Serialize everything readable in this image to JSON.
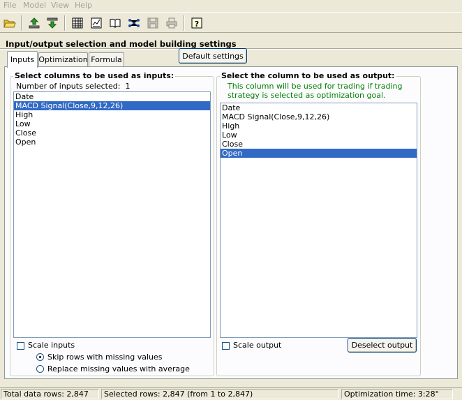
{
  "menu": [
    "File",
    "Model",
    "View",
    "Help"
  ],
  "toolbar": {
    "icons": [
      "open-folder-icon",
      "upload-icon",
      "download-icon",
      "grid-icon",
      "chart-icon",
      "book-icon",
      "network-icon",
      "save-icon",
      "print-icon",
      "help-icon"
    ]
  },
  "section": {
    "title": "Input/output selection and model building settings"
  },
  "tabs": [
    {
      "label": "Inputs",
      "active": true
    },
    {
      "label": "Optimization",
      "active": false
    },
    {
      "label": "Formula",
      "active": false
    }
  ],
  "default_settings_label": "Default settings",
  "inputs": {
    "title": "Select columns to be used as inputs:",
    "count_label": "Number of inputs selected:",
    "count_value": "1",
    "columns": [
      "Date",
      "MACD Signal(Close,9,12,26)",
      "High",
      "Low",
      "Close",
      "Open"
    ],
    "selected_index": 1,
    "scale_label": "Scale inputs",
    "skip_label": "Skip rows with missing values",
    "replace_label": "Replace missing values with average"
  },
  "output": {
    "title": "Select the column to be used as output:",
    "note_line1": "This column will be used for trading if trading",
    "note_line2": "strategy is selected as optimization goal.",
    "columns": [
      "Date",
      "MACD Signal(Close,9,12,26)",
      "High",
      "Low",
      "Close",
      "Open"
    ],
    "selected_index": 5,
    "scale_label": "Scale output",
    "deselect_label": "Deselect output"
  },
  "status": {
    "total_rows": "Total data rows: 2,847",
    "selected_rows": "Selected rows: 2,847  (from 1 to 2,847)",
    "optimization_time": "Optimization time: 3:28\""
  }
}
